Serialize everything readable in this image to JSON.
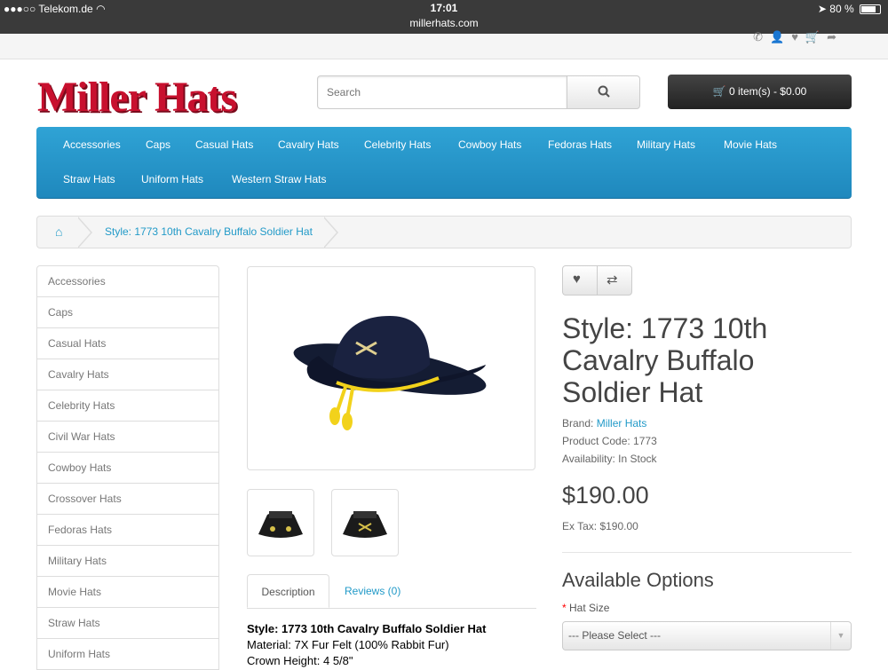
{
  "status": {
    "carrier": "Telekom.de",
    "time": "17:01",
    "url": "millerhats.com",
    "battery": "80 %",
    "battery_level": 0.8
  },
  "header": {
    "logo": "Miller Hats",
    "search_placeholder": "Search",
    "cart_label": "0 item(s) - $0.00"
  },
  "menu": [
    "Accessories",
    "Caps",
    "Casual Hats",
    "Cavalry Hats",
    "Celebrity Hats",
    "Cowboy Hats",
    "Fedoras Hats",
    "Military Hats",
    "Movie Hats",
    "Straw Hats",
    "Uniform Hats",
    "Western Straw Hats"
  ],
  "breadcrumb": {
    "current": "Style: 1773 10th Cavalry Buffalo Soldier Hat"
  },
  "sidebar": [
    "Accessories",
    "Caps",
    "Casual Hats",
    "Cavalry Hats",
    "Celebrity Hats",
    "Civil War Hats",
    "Cowboy Hats",
    "Crossover Hats",
    "Fedoras Hats",
    "Military Hats",
    "Movie Hats",
    "Straw Hats",
    "Uniform Hats"
  ],
  "tabs": {
    "description": "Description",
    "reviews": "Reviews (0)"
  },
  "description": {
    "heading": "Style: 1773 10th Cavalry Buffalo Soldier Hat",
    "material": "Material: 7X Fur Felt (100% Rabbit Fur)",
    "crown": "Crown Height: 4 5/8\""
  },
  "product": {
    "title": "Style: 1773 10th Cavalry Buffalo Soldier Hat",
    "brand_label": "Brand:",
    "brand": "Miller Hats",
    "code": "Product Code: 1773",
    "availability": "Availability: In Stock",
    "price": "$190.00",
    "ex_tax": "Ex Tax: $190.00",
    "options_title": "Available Options",
    "hat_size_label": "Hat Size",
    "hat_size_value": "--- Please Select ---"
  },
  "colors": {
    "accent": "#229ac8",
    "menu": "#2fa3d5",
    "logo": "#c8102e",
    "cord": "#f2d21b"
  }
}
